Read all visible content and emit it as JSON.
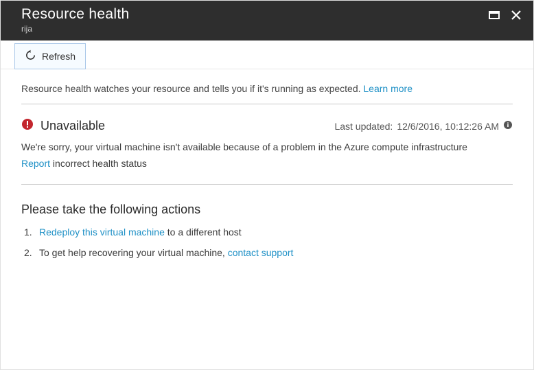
{
  "header": {
    "title": "Resource health",
    "subtitle": "rija"
  },
  "toolbar": {
    "refresh_label": "Refresh"
  },
  "intro": {
    "text": "Resource health watches your resource and tells you if it's running as expected. ",
    "learn_more": "Learn more"
  },
  "status": {
    "title": "Unavailable",
    "last_updated_label": "Last updated: ",
    "last_updated_value": "12/6/2016, 10:12:26 AM",
    "description": "We're sorry, your virtual machine isn't available because of a problem in the Azure compute infrastructure",
    "report_link": "Report",
    "report_suffix": " incorrect health status"
  },
  "actions": {
    "heading": "Please take the following actions",
    "items": [
      {
        "num": "1.",
        "link": "Redeploy this virtual machine",
        "suffix": " to a different host"
      },
      {
        "num": "2.",
        "prefix": "To get help recovering your virtual machine, ",
        "link": "contact support"
      }
    ]
  }
}
